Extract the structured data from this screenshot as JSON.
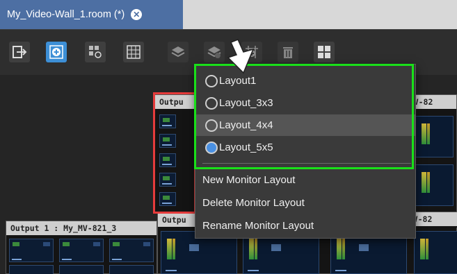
{
  "tab": {
    "title": "My_Video-Wall_1.room (*)",
    "close_icon": "close-icon"
  },
  "toolbar": {
    "buttons": [
      {
        "name": "exit-icon"
      },
      {
        "name": "add-device-icon",
        "active": true
      },
      {
        "name": "link-device-icon"
      },
      {
        "name": "grid-icon"
      },
      {
        "name": "layers-icon"
      },
      {
        "name": "layers-layout-icon"
      },
      {
        "name": "add-grid-icon"
      },
      {
        "name": "delete-icon"
      },
      {
        "name": "quad-layout-icon"
      }
    ]
  },
  "panels": {
    "left_bottom_title": "Output 1 : My_MV-821_3",
    "center_top_title": "Outpu",
    "center_bottom_title": "Outpu",
    "right_top_title": "My_MV-82",
    "right_bottom_title": "My_MV-82"
  },
  "menu": {
    "layouts": [
      {
        "label": "Layout1",
        "checked": false
      },
      {
        "label": "Layout_3x3",
        "checked": false
      },
      {
        "label": "Layout_4x4",
        "checked": false,
        "highlighted": true
      },
      {
        "label": "Layout_5x5",
        "checked": true
      }
    ],
    "actions": {
      "new": "New Monitor Layout",
      "delete": "Delete Monitor Layout",
      "rename": "Rename Monitor Layout"
    }
  },
  "colors": {
    "tab_bg": "#4d6fa3",
    "accent": "#3d8fd6",
    "highlight_frame": "#19e019",
    "selection_frame": "#e53b3b"
  }
}
